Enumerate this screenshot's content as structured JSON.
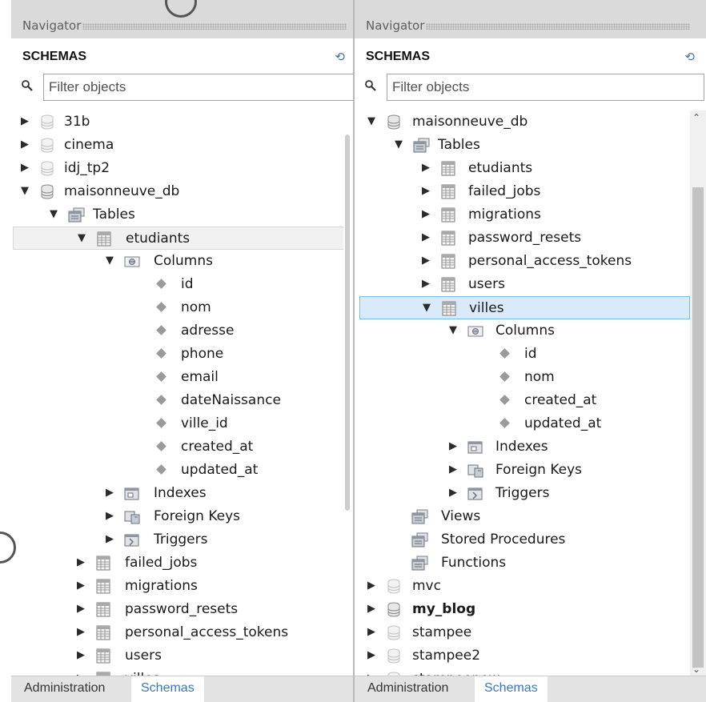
{
  "left_panel": {
    "navigator_title": "Navigator",
    "schemas_title": "SCHEMAS",
    "filter_placeholder": "Filter objects",
    "rows": [
      {
        "label": "31b"
      },
      {
        "label": "cinema"
      },
      {
        "label": "idj_tp2"
      },
      {
        "label": "maisonneuve_db"
      },
      {
        "label": "Tables"
      },
      {
        "label": "etudiants"
      },
      {
        "label": "Columns"
      },
      {
        "label": "id"
      },
      {
        "label": "nom"
      },
      {
        "label": "adresse"
      },
      {
        "label": "phone"
      },
      {
        "label": "email"
      },
      {
        "label": "dateNaissance"
      },
      {
        "label": "ville_id"
      },
      {
        "label": "created_at"
      },
      {
        "label": "updated_at"
      },
      {
        "label": "Indexes"
      },
      {
        "label": "Foreign Keys"
      },
      {
        "label": "Triggers"
      },
      {
        "label": "failed_jobs"
      },
      {
        "label": "migrations"
      },
      {
        "label": "password_resets"
      },
      {
        "label": "personal_access_tokens"
      },
      {
        "label": "users"
      },
      {
        "label": "villes"
      }
    ],
    "tabs": {
      "administration": "Administration",
      "schemas": "Schemas"
    }
  },
  "right_panel": {
    "navigator_title": "Navigator",
    "schemas_title": "SCHEMAS",
    "filter_placeholder": "Filter objects",
    "rows": [
      {
        "label": "maisonneuve_db"
      },
      {
        "label": "Tables"
      },
      {
        "label": "etudiants"
      },
      {
        "label": "failed_jobs"
      },
      {
        "label": "migrations"
      },
      {
        "label": "password_resets"
      },
      {
        "label": "personal_access_tokens"
      },
      {
        "label": "users"
      },
      {
        "label": "villes"
      },
      {
        "label": "Columns"
      },
      {
        "label": "id"
      },
      {
        "label": "nom"
      },
      {
        "label": "created_at"
      },
      {
        "label": "updated_at"
      },
      {
        "label": "Indexes"
      },
      {
        "label": "Foreign Keys"
      },
      {
        "label": "Triggers"
      },
      {
        "label": "Views"
      },
      {
        "label": "Stored Procedures"
      },
      {
        "label": "Functions"
      },
      {
        "label": "mvc"
      },
      {
        "label": "my_blog"
      },
      {
        "label": "stampee"
      },
      {
        "label": "stampee2"
      },
      {
        "label": "stampeenew"
      }
    ],
    "tabs": {
      "administration": "Administration",
      "schemas": "Schemas"
    }
  },
  "glyphs": {
    "collapsed": "▶",
    "expanded": "▼",
    "refresh": "⟲",
    "scroll_up": "⌃",
    "scroll_down": "⌄"
  },
  "colors": {
    "accent": "#3a76c4",
    "selection_blue": "#d9ebfa"
  }
}
